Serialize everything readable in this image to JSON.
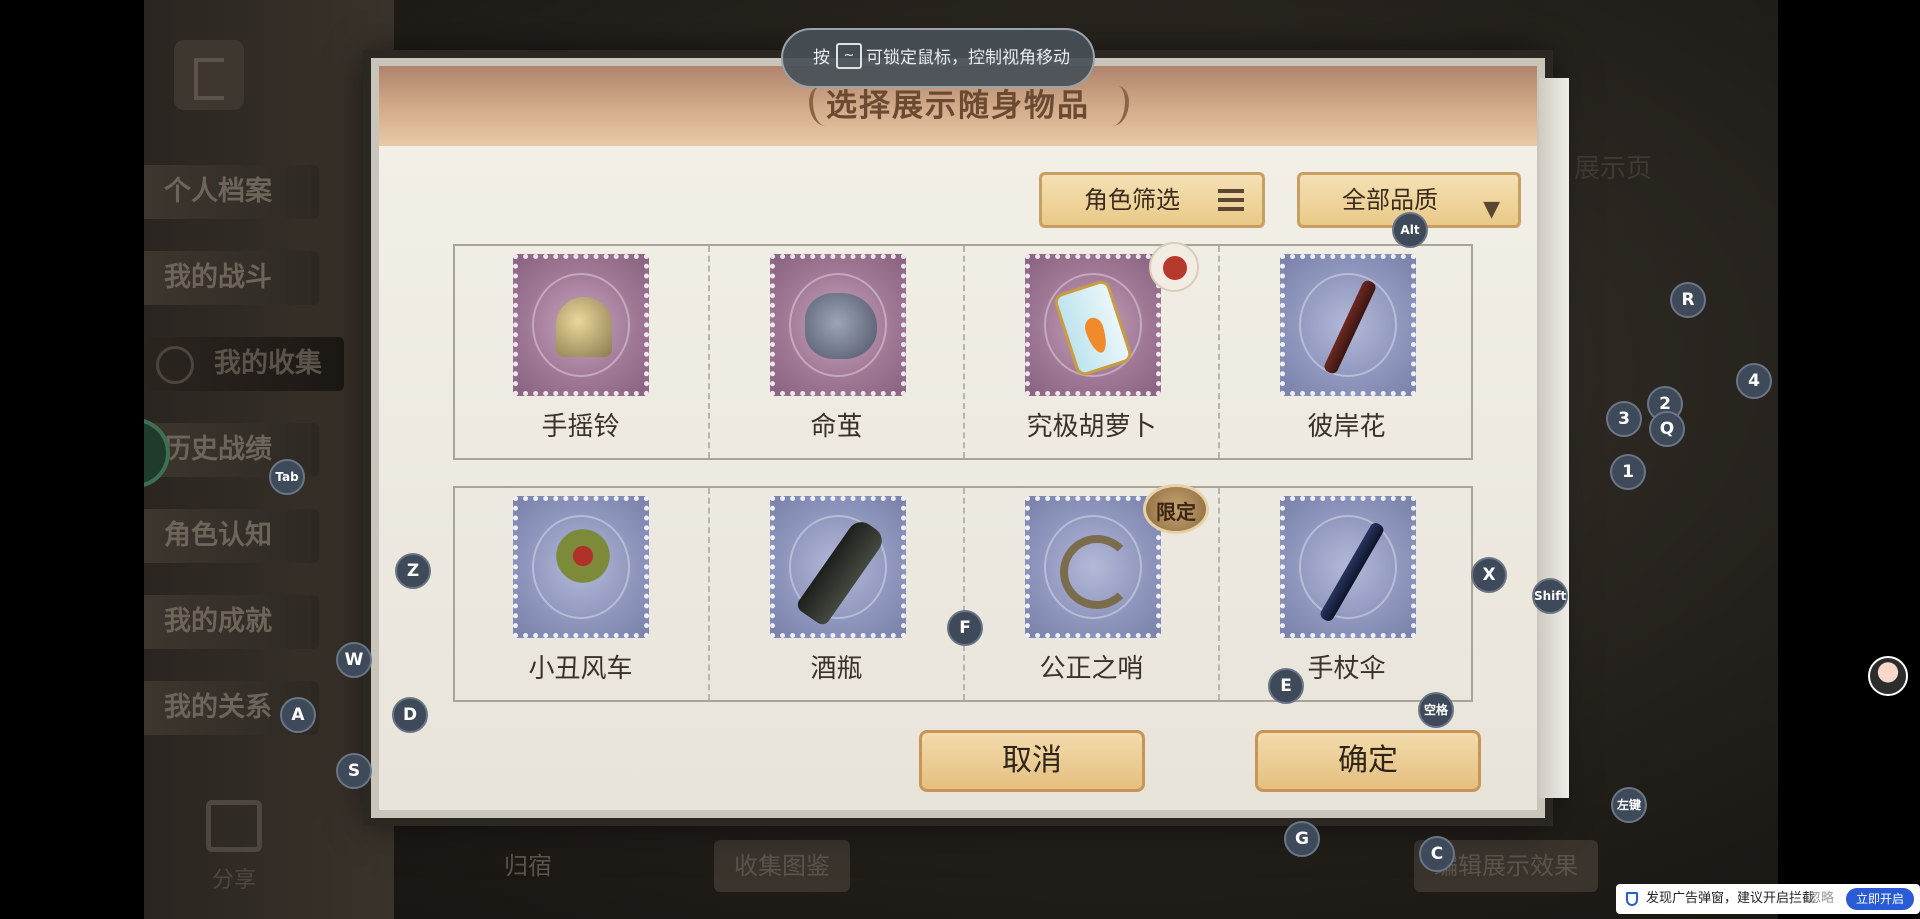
{
  "left_nav": {
    "items": [
      {
        "label": "个人档案"
      },
      {
        "label": "我的战斗"
      },
      {
        "label": "我的收集"
      },
      {
        "label": "历史战绩"
      },
      {
        "label": "角色认知"
      },
      {
        "label": "我的成就"
      },
      {
        "label": "我的关系"
      }
    ],
    "share_label": "分享"
  },
  "background": {
    "right_label": "展示页",
    "bottom_items": [
      "归宿",
      "收集图鉴",
      "编辑展示效果"
    ]
  },
  "hint": {
    "prefix": "按",
    "key": "~",
    "text": "可锁定鼠标，控制视角移动"
  },
  "dialog": {
    "title": "选择展示随身物品",
    "filter_role_label": "角色筛选",
    "filter_quality_label": "全部品质",
    "items": [
      {
        "label": "手摇铃",
        "frame": "purple"
      },
      {
        "label": "命茧",
        "frame": "purple"
      },
      {
        "label": "究极胡萝卜",
        "frame": "purple"
      },
      {
        "label": "彼岸花",
        "frame": "blue"
      },
      {
        "label": "小丑风车",
        "frame": "blue"
      },
      {
        "label": "酒瓶",
        "frame": "blue"
      },
      {
        "label": "公正之哨",
        "frame": "blue",
        "badge": "限定"
      },
      {
        "label": "手杖伞",
        "frame": "blue"
      }
    ],
    "cancel_label": "取消",
    "confirm_label": "确定"
  },
  "key_overlays": [
    "Alt",
    "R",
    "4",
    "2",
    "3",
    "Q",
    "1",
    "Tab",
    "Z",
    "X",
    "Shift",
    "F",
    "W",
    "E",
    "空格",
    "A",
    "D",
    "S",
    "左键",
    "G",
    "C"
  ],
  "ad_bar": {
    "text": "发现广告弹窗，建议开启拦截",
    "ignore_label": "忽略",
    "open_label": "立即开启"
  },
  "colors": {
    "button_gold": "#e9c987",
    "key_bg": "#3e4a5a",
    "ad_blue": "#2a5bd7"
  }
}
